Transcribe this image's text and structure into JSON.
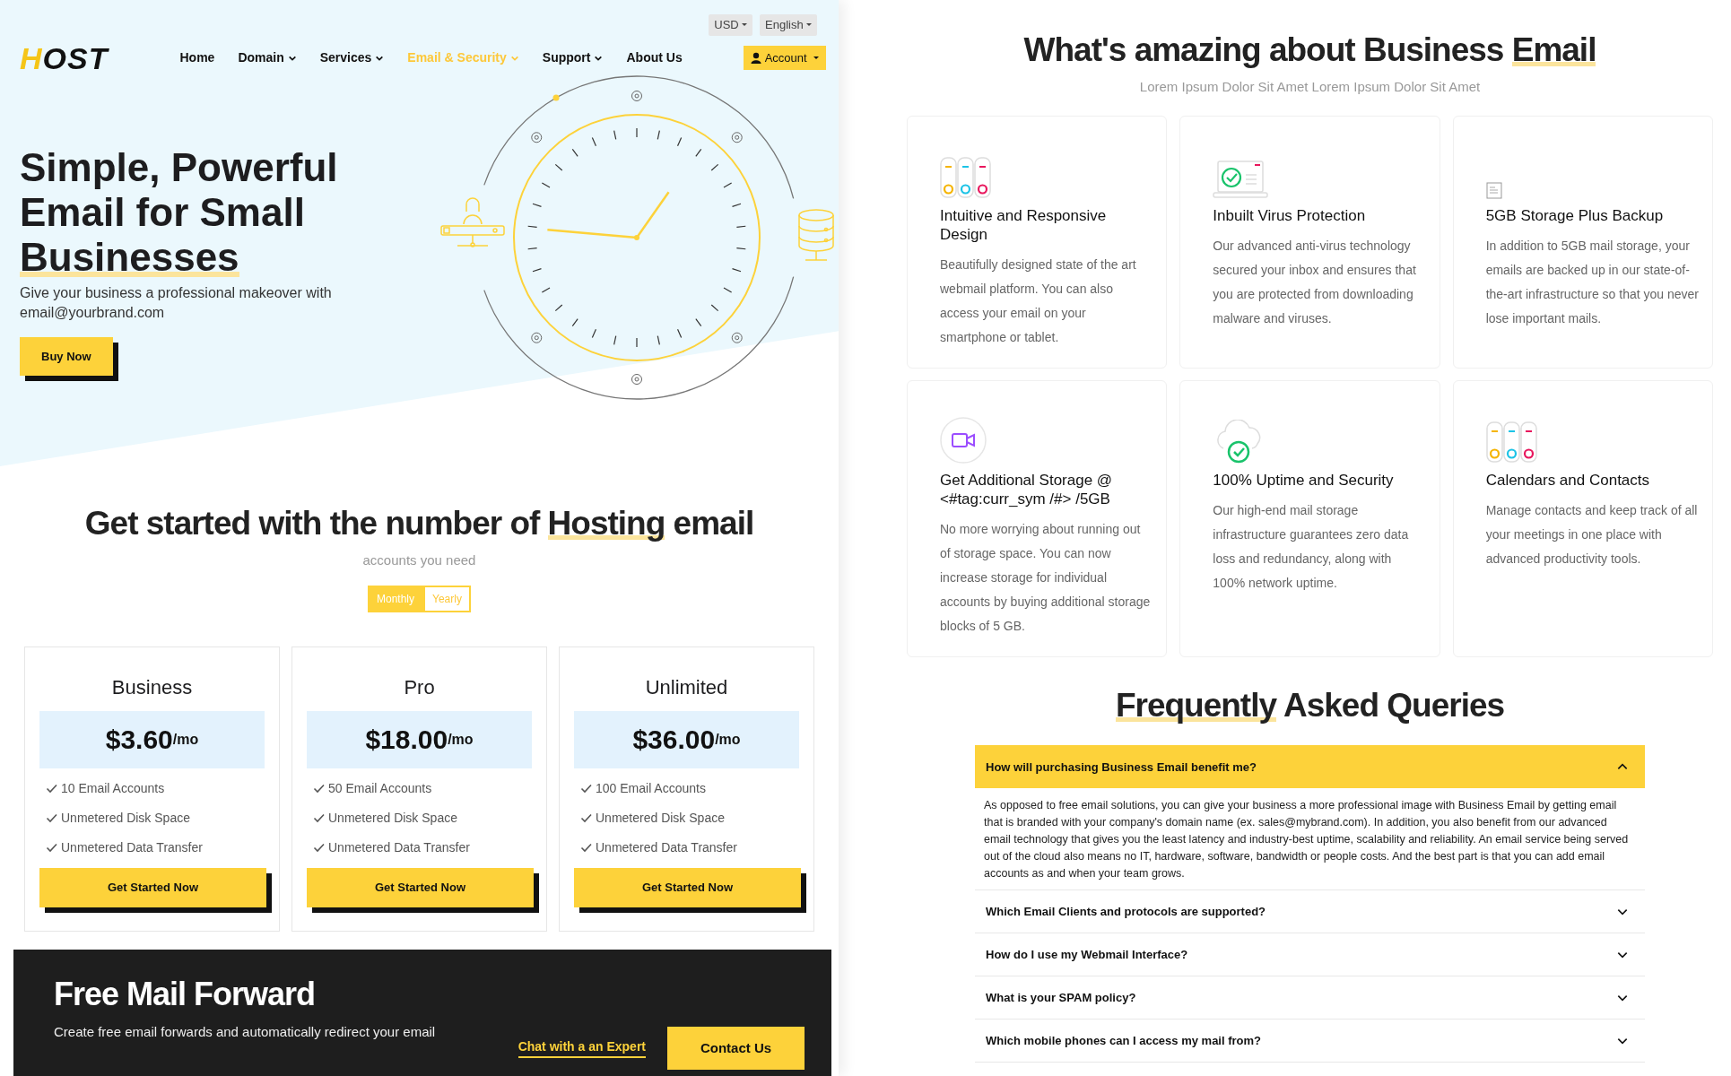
{
  "top_bar": {
    "currency": "USD",
    "language": "English"
  },
  "header": {
    "logo": "HOST",
    "account_button": "Account"
  },
  "nav": [
    {
      "label": "Home",
      "dropdown": false,
      "selected": false
    },
    {
      "label": "Domain",
      "dropdown": true,
      "selected": false
    },
    {
      "label": "Services",
      "dropdown": true,
      "selected": false
    },
    {
      "label": "Email & Security",
      "dropdown": true,
      "selected": true
    },
    {
      "label": "Support",
      "dropdown": true,
      "selected": false
    },
    {
      "label": "About Us",
      "dropdown": false,
      "selected": false
    }
  ],
  "hero": {
    "title": "Simple, Powerful Email for Small ",
    "title_highlight": "Businesses",
    "subtitle": "Give your business a professional makeover with email@yourbrand.com",
    "button": "Buy Now"
  },
  "pricing": {
    "heading": "Get started with the number of ",
    "heading_highlight": "Hosting",
    "heading_end": " email",
    "subtitle": "accounts you need",
    "billing": [
      {
        "label": "Monthly",
        "selected": true
      },
      {
        "label": "Yearly",
        "selected": false
      }
    ],
    "plans": [
      {
        "name": "Business",
        "price": "$3.60",
        "period": "/mo",
        "features": [
          "10 Email Accounts",
          "Unmetered Disk Space",
          "Unmetered Data Transfer"
        ],
        "button": "Get Started Now"
      },
      {
        "name": "Pro",
        "price": "$18.00",
        "period": "/mo",
        "features": [
          "50 Email Accounts",
          "Unmetered Disk Space",
          "Unmetered Data Transfer"
        ],
        "button": "Get Started Now"
      },
      {
        "name": "Unlimited",
        "price": "$36.00",
        "period": "/mo",
        "features": [
          "100 Email Accounts",
          "Unmetered Disk Space",
          "Unmetered Data Transfer"
        ],
        "button": "Get Started Now"
      }
    ]
  },
  "forward_banner": {
    "title": "Free Mail Forward",
    "text": "Create free email forwards and automatically redirect your email",
    "link": "Chat with a an Expert",
    "button": "Contact Us"
  },
  "features": {
    "heading": "What's amazing about Business ",
    "heading_highlight": "Email",
    "subtitle": "Lorem Ipsum Dolor Sit Amet Lorem Ipsum Dolor Sit Amet",
    "items": [
      {
        "kind": "servers",
        "title": "Intuitive and Responsive Design",
        "text": "Beautifully designed state of the art webmail platform. You can also access your email on your smartphone or tablet."
      },
      {
        "kind": "laptop-check",
        "title": "Inbuilt Virus Protection",
        "text": "Our advanced anti-virus technology secured your inbox and ensures that you are protected from downloading malware and viruses."
      },
      {
        "kind": "document",
        "title": "5GB Storage Plus Backup",
        "text": "In addition to 5GB mail storage, your emails are backed up in our state-of-the-art infrastructure so that you never lose important mails."
      },
      {
        "kind": "video",
        "title": "Get Additional Storage @ <#tag:curr_sym /#> /5GB",
        "text": "No more worrying about running out of storage space. You can now increase storage for individual accounts by buying additional storage blocks of 5 GB."
      },
      {
        "kind": "cloud-check",
        "title": "100% Uptime and Security",
        "text": "Our high-end mail storage infrastructure guarantees zero data loss and redundancy, along with 100% network uptime."
      },
      {
        "kind": "servers",
        "title": "Calendars and Contacts",
        "text": "Manage contacts and keep track of all your meetings in one place with advanced productivity tools."
      }
    ]
  },
  "faq": {
    "heading_highlight": "Frequently",
    "heading": " Asked Queries",
    "items": [
      {
        "question": "How will purchasing Business Email benefit me?",
        "expanded": true,
        "answer": "As opposed to free email solutions, you can give your business a more professional image with Business Email by getting email that is branded with your company's domain name (ex. sales@mybrand.com). In addition, you also benefit from our advanced email technology that gives you the least latency and industry-best uptime, scalability and reliability. An email service being served out of the cloud also means no IT, hardware, software, bandwidth or people costs. And the best part is that you can add email accounts as and when your team grows."
      },
      {
        "question": "Which Email Clients and protocols are supported?",
        "expanded": false
      },
      {
        "question": "How do I use my Webmail Interface?",
        "expanded": false
      },
      {
        "question": "What is your SPAM policy?",
        "expanded": false
      },
      {
        "question": "Which mobile phones can I access my mail from?",
        "expanded": false
      }
    ]
  }
}
